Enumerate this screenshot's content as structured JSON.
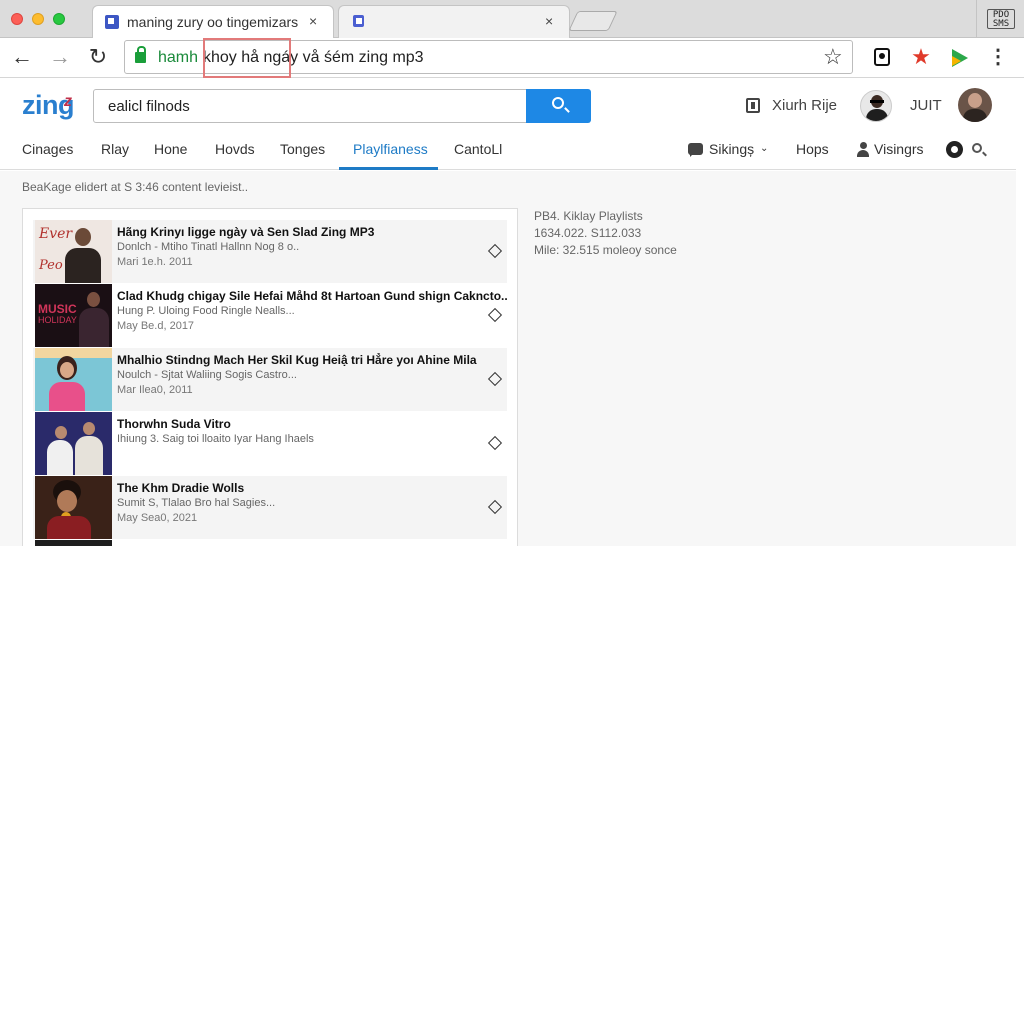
{
  "browser": {
    "tabs": [
      {
        "title": "maning zury oo tingemizars",
        "close": "×"
      },
      {
        "title": "",
        "close": "×"
      }
    ],
    "top_right_ext": "PDO\nSMS",
    "url_scheme": "hamh",
    "url_text": "khoy hå ngáy vå śém zing mp3",
    "icons": [
      "back-icon",
      "forward-icon",
      "reload-icon",
      "lock-icon",
      "star-icon",
      "camera-ext-icon",
      "red-star-ext-icon",
      "play-store-ext-icon",
      "menu-icon"
    ]
  },
  "header": {
    "logo": "zing",
    "logo_sup": "z",
    "search_value": "ealicl filnods",
    "user_link": "Xiurh Rije",
    "account_label": "JUIT"
  },
  "subnav": {
    "items": [
      "Cinages",
      "Rlay",
      "Hone",
      "Hovds",
      "Tonges",
      "Playlfianess",
      "CantoLl"
    ],
    "active_index": 5,
    "right_items": [
      "Sikingș",
      "Hops",
      "Visingrs"
    ]
  },
  "content": {
    "notice": "BeaKage elidert at S 3:46 content levieist..",
    "results": [
      {
        "title": "Hãng Krinyı ligge ngày và Sen Slad Zing MP3",
        "subtitle": "Donlch - Mtiho Tinatl Hallnn Nog 8 o..",
        "date": "Mari 1e.h. 2011"
      },
      {
        "title": "Clad Khudg chigay Sile Hefai Måhd 8t Hartoan Gund shign Cakncto..",
        "subtitle": "Hung P.  Uloing Food Ringle Nealls...",
        "date": "May Be.d, 2017"
      },
      {
        "title": "Mhalhio Stindng Mach Her Skil Kug Heiậ tri Hẳre yoı Ahine Mila",
        "subtitle": "Noulch -  Sjtat Waliing Sogis Castro...",
        "date": "Mar Ilea0, 2011"
      },
      {
        "title": "Thorwhn Suda Vitro",
        "subtitle": "Ihiung 3. Saig toi lloaito Iyar Hang Ihaels",
        "date": ""
      },
      {
        "title": "The Khm Dradie Wolls",
        "subtitle": "Sumit S, Tlalao Bro hal Sagies...",
        "date": "May Sea0, 2021"
      }
    ],
    "info": {
      "line1": "PB4. Kiklay Playlists",
      "line2": "1634.022. S112.033",
      "line3": "Mile: 32.515 moleoy sonce"
    }
  },
  "colors": {
    "accent": "#1e88e5",
    "active_tab": "#1e7bc6",
    "logo": "#2a7fcf"
  }
}
